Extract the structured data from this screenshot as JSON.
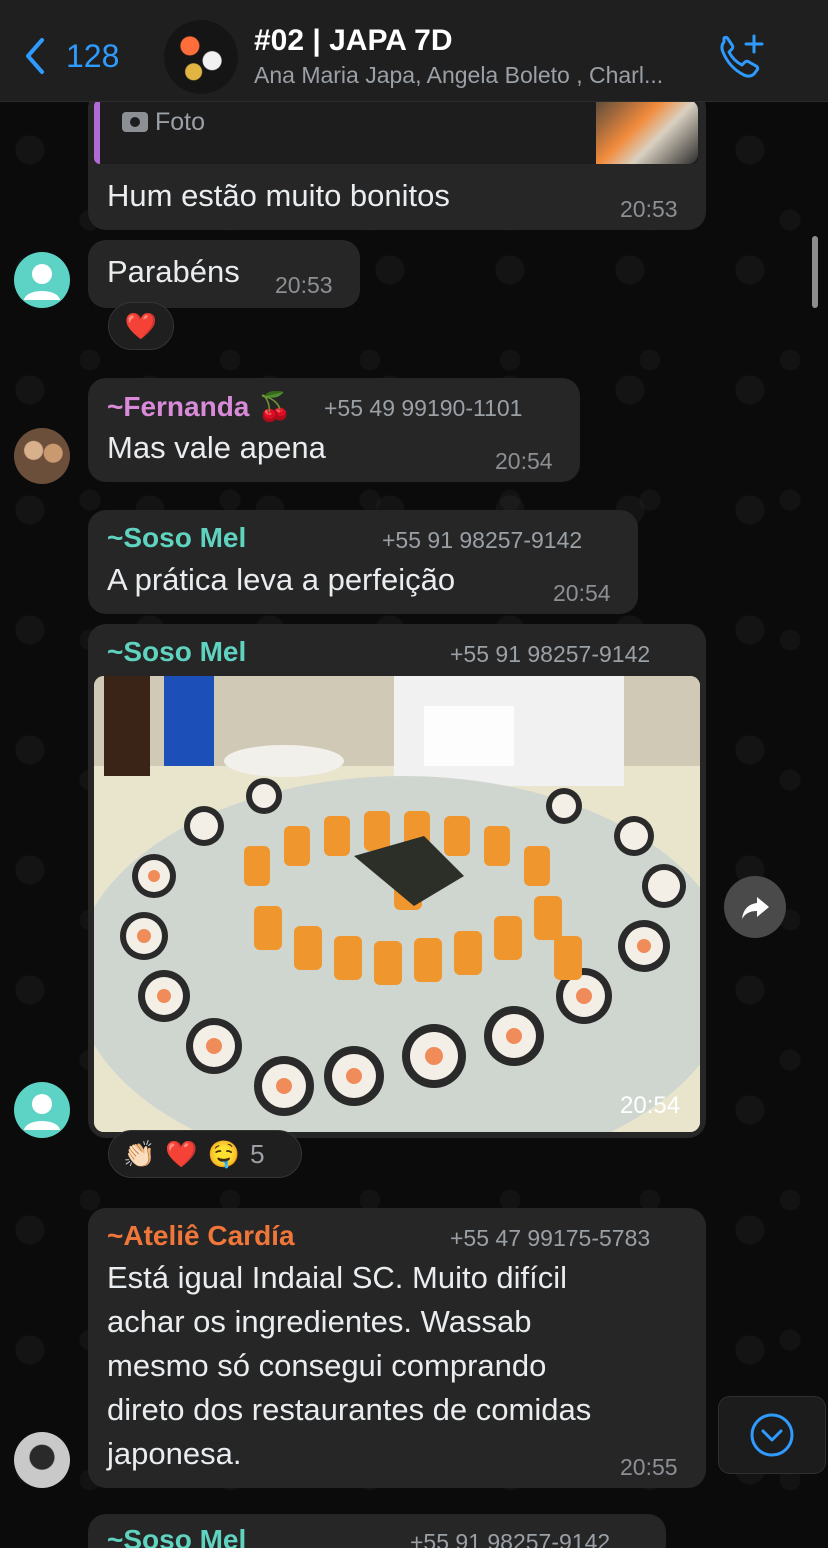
{
  "header": {
    "back_count": "128",
    "group_title": "#02 | JAPA 7D",
    "members_preview": "Ana Maria Japa, Angela Boleto , Charl...",
    "call_icon": "phone-plus-icon"
  },
  "messages": [
    {
      "reply_label": "Foto",
      "text": "Hum estão  muito bonitos",
      "time": "20:53"
    },
    {
      "text": "Parabéns",
      "time": "20:53",
      "reactions": [
        "❤️"
      ]
    },
    {
      "sender": "~Fernanda 🍒",
      "phone": "+55 49 99190-1101",
      "text": "Mas vale apena",
      "time": "20:54"
    },
    {
      "sender": "~Soso Mel",
      "phone": "+55 91 98257-9142",
      "text": "A prática leva a perfeição",
      "time": "20:54"
    },
    {
      "sender": "~Soso Mel",
      "phone": "+55 91 98257-9142",
      "time": "20:54",
      "reactions": [
        "👏🏻",
        "❤️",
        "🤤"
      ],
      "reaction_count": "5"
    },
    {
      "sender": "~Ateliê Cardía",
      "phone": "+55 47 99175-5783",
      "lines": [
        "Está igual Indaial SC.  Muito difícil",
        "achar os ingredientes. Wassab",
        "mesmo só consegui comprando",
        "direto dos restaurantes de comidas",
        "japonesa."
      ],
      "time": "20:55"
    },
    {
      "sender": "~Soso Mel",
      "phone": "+55 91 98257-9142"
    }
  ],
  "colors": {
    "accent_blue": "#2f9bff",
    "sender_fernanda": "#d98bd9",
    "sender_soso": "#5fd3c0",
    "sender_atelie": "#f0763a",
    "bubble": "#262626"
  }
}
